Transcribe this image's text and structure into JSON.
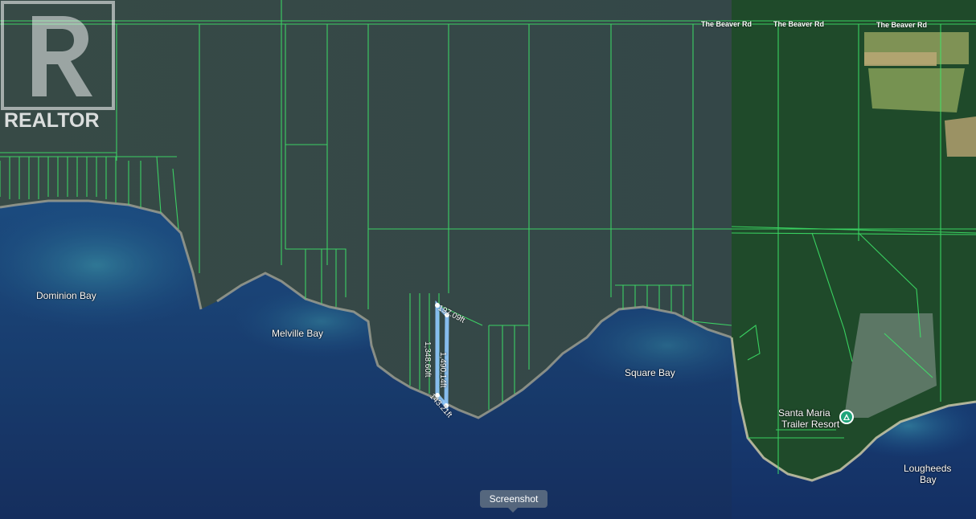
{
  "logo": {
    "text": "REALTOR"
  },
  "roads": [
    "The Beaver Rd",
    "The Beaver Rd",
    "The Beaver Rd"
  ],
  "places": {
    "dominion_bay": "Dominion Bay",
    "melville_bay": "Melville Bay",
    "square_bay": "Square Bay",
    "santa_maria_line1": "Santa Maria",
    "santa_maria_line2": "Trailer Resort",
    "lougheeds_line1": "Lougheeds",
    "lougheeds_line2": "Bay"
  },
  "measurements": {
    "top": "197.09ft",
    "left": "1,348.60ft",
    "right": "1,490.14ft",
    "bottom": "143.21ft"
  },
  "screenshot_button": "Screenshot",
  "icons": {
    "campground": "campground-icon"
  },
  "colors": {
    "parcel_line": "#3ee86a",
    "measure_line": "#8fc9ff",
    "water": "#1e4e8c",
    "forest": "#2d4530"
  }
}
